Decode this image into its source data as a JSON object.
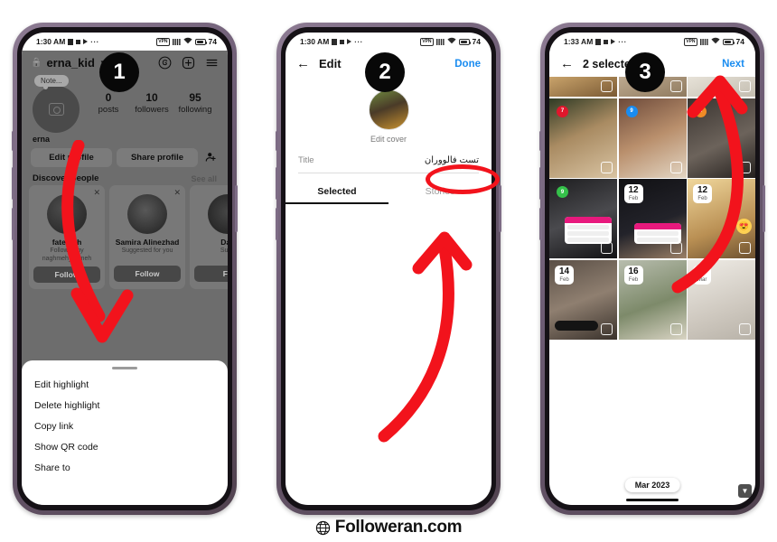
{
  "footer": {
    "brand": "Followeran.com",
    "icon": "globe-icon"
  },
  "steps": {
    "one": "1",
    "two": "2",
    "three": "3"
  },
  "colors": {
    "accent_blue": "#1a8cf0",
    "annotation_red": "#f2131c",
    "follow_blue": "#1268b3",
    "badge_black": "#080808"
  },
  "phone1": {
    "status": {
      "time": "1:30 AM",
      "battery": "74",
      "icons": [
        "square-icon",
        "stop-icon",
        "play-icon",
        "more-dots-icon",
        "vpn-icon",
        "signal-icon",
        "wifi-icon",
        "battery-icon"
      ]
    },
    "header": {
      "lock_icon": "lock-icon",
      "username": "erna_kid",
      "chevron_icon": "chevron-down-icon",
      "threads_icon": "threads-icon",
      "add_icon": "plus-square-icon",
      "menu_icon": "hamburger-icon"
    },
    "profile": {
      "note": "Note...",
      "avatar_icon": "camera-icon",
      "stats": [
        {
          "number": "0",
          "label": "posts"
        },
        {
          "number": "10",
          "label": "followers"
        },
        {
          "number": "95",
          "label": "following"
        }
      ],
      "bio": "erna",
      "edit_profile": "Edit profile",
      "share_profile": "Share profile",
      "add_user_icon": "add-person-icon"
    },
    "discover": {
      "title": "Discover people",
      "see_all": "See all",
      "cards": [
        {
          "name": "fatemeh",
          "sub": "Followed by naghmeh_nameh",
          "follow": "Follow"
        },
        {
          "name": "Samira Alinezhad",
          "sub": "Suggested for you",
          "follow": "Follow"
        },
        {
          "name": "Dav",
          "sub": "Sugg",
          "follow": "Fo"
        }
      ]
    },
    "sheet": {
      "items": [
        "Edit highlight",
        "Delete highlight",
        "Copy link",
        "Show QR code",
        "Share to"
      ]
    }
  },
  "phone2": {
    "status": {
      "time": "1:30 AM",
      "battery": "74"
    },
    "nav": {
      "back_icon": "arrow-left-icon",
      "title": "Edit",
      "done": "Done"
    },
    "cover": {
      "label": "Edit cover"
    },
    "title_field": {
      "label": "Title",
      "value": "تست فالووران"
    },
    "tabs": [
      {
        "label": "Selected",
        "active": true
      },
      {
        "label": "Stories",
        "active": false
      }
    ]
  },
  "phone3": {
    "status": {
      "time": "1:33 AM",
      "battery": "74"
    },
    "nav": {
      "back_icon": "arrow-left-icon",
      "title": "2 selected",
      "next": "Next"
    },
    "month_chip": "Mar 2023",
    "scroll_icon": "chevron-down-icon",
    "grid": [
      {
        "badge": "",
        "badge_color": "",
        "date_day": "",
        "date_mon": "",
        "selected": false,
        "bg": "linear-gradient(160deg,#c9a36b,#7a5a34)"
      },
      {
        "badge": "",
        "badge_color": "",
        "date_day": "",
        "date_mon": "",
        "selected": false,
        "bg": "linear-gradient(160deg,#bda98f,#8f7a5f)"
      },
      {
        "badge": "",
        "badge_color": "",
        "date_day": "",
        "date_mon": "",
        "selected": false,
        "bg": "linear-gradient(160deg,#e7e2d8,#c3bdb0)"
      },
      {
        "badge": "7",
        "badge_color": "#e0162c",
        "date_day": "",
        "date_mon": "",
        "selected": false,
        "bg": "linear-gradient(155deg,#2f3a24,#a98b62 45%,#d9c4a3)"
      },
      {
        "badge": "9",
        "badge_color": "#1a8cf0",
        "date_day": "",
        "date_mon": "",
        "selected": false,
        "bg": "linear-gradient(155deg,#6d4a3a,#b98f6c 50%,#e3d6c4)"
      },
      {
        "badge": "6",
        "badge_color": "#f08b26",
        "date_day": "",
        "date_mon": "",
        "selected": false,
        "bg": "linear-gradient(155deg,#3a3430,#6c635b 55%,#241f1d)"
      },
      {
        "badge": "9",
        "badge_color": "#35c14a",
        "date_day": "",
        "date_mon": "",
        "selected": false,
        "bg": "linear-gradient(160deg,#1e1e20,#4a4a4e 50%,#121214)"
      },
      {
        "badge": "",
        "badge_color": "",
        "date_day": "12",
        "date_mon": "Feb",
        "selected": false,
        "bg": "linear-gradient(160deg,#101013,#23232a 55%,#9a7f66)"
      },
      {
        "badge": "",
        "badge_color": "",
        "date_day": "12",
        "date_mon": "Feb",
        "selected": false,
        "bg": "linear-gradient(160deg,#f0d79c,#b98f53 60%,#6d5130)"
      },
      {
        "badge": "",
        "badge_color": "",
        "date_day": "14",
        "date_mon": "Feb",
        "selected": false,
        "bg": "linear-gradient(160deg,#5a4f46,#8f7f70 50%,#3a322c)"
      },
      {
        "badge": "",
        "badge_color": "",
        "date_day": "16",
        "date_mon": "Feb",
        "selected": false,
        "bg": "linear-gradient(160deg,#b8bdae,#7d8a6a 55%,#d9d4c4)"
      },
      {
        "badge": "",
        "badge_color": "",
        "date_day": "1",
        "date_mon": "Mar",
        "selected": false,
        "bg": "linear-gradient(160deg,#efece6,#cfc9c0 60%,#b8b2a8)"
      }
    ]
  }
}
